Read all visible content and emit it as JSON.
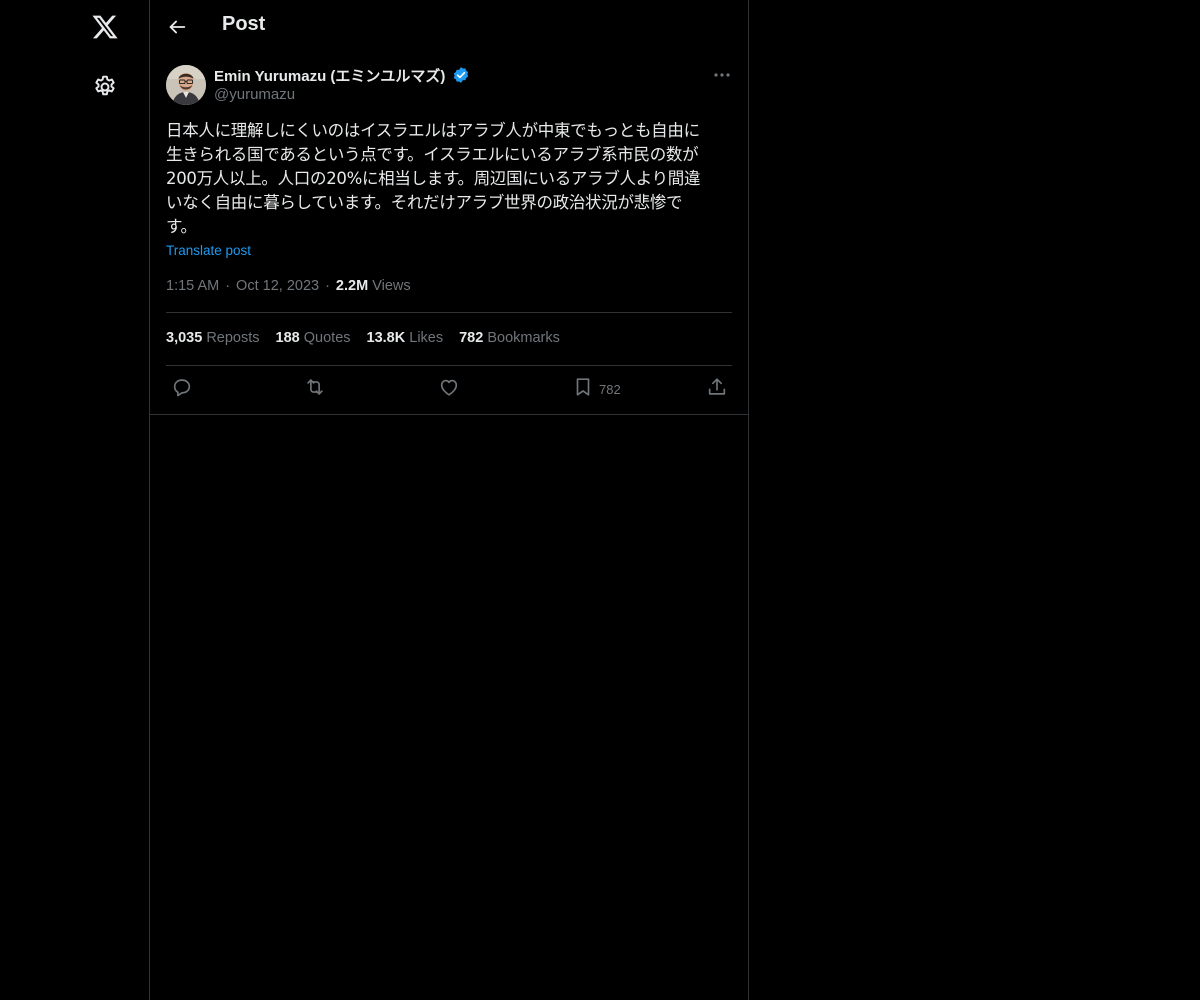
{
  "header": {
    "title": "Post"
  },
  "post": {
    "author_name": "Emin Yurumazu (エミンユルマズ)",
    "handle": "@yurumazu",
    "text": "日本人に理解しにくいのはイスラエルはアラブ人が中東でもっとも自由に\n生きられる国であるという点です。イスラエルにいるアラブ系市民の数が\n200万人以上。人口の20%に相当します。周辺国にいるアラブ人より間違\nいなく自由に暮らしています。それだけアラブ世界の政治状況が悲惨で\nす。",
    "translate_label": "Translate post",
    "time": "1:15 AM",
    "date": "Oct 12, 2023",
    "views_count": "2.2M",
    "views_label": "Views",
    "stats": {
      "reposts_count": "3,035",
      "reposts_label": "Reposts",
      "quotes_count": "188",
      "quotes_label": "Quotes",
      "likes_count": "13.8K",
      "likes_label": "Likes",
      "bookmarks_count": "782",
      "bookmarks_label": "Bookmarks"
    },
    "actions": {
      "bookmark_count": "782"
    }
  },
  "icons": {
    "logo": "x-logo-icon",
    "settings": "gear-icon",
    "back": "arrow-left-icon",
    "verified": "verified-badge-icon",
    "more": "more-horizontal-icon",
    "reply": "reply-icon",
    "repost": "repost-icon",
    "like": "heart-icon",
    "bookmark": "bookmark-icon",
    "share": "share-icon"
  },
  "colors": {
    "background": "#000000",
    "text_primary": "#e7e9ea",
    "text_secondary": "#71767b",
    "accent": "#1d9bf0",
    "border": "#2f3336"
  }
}
